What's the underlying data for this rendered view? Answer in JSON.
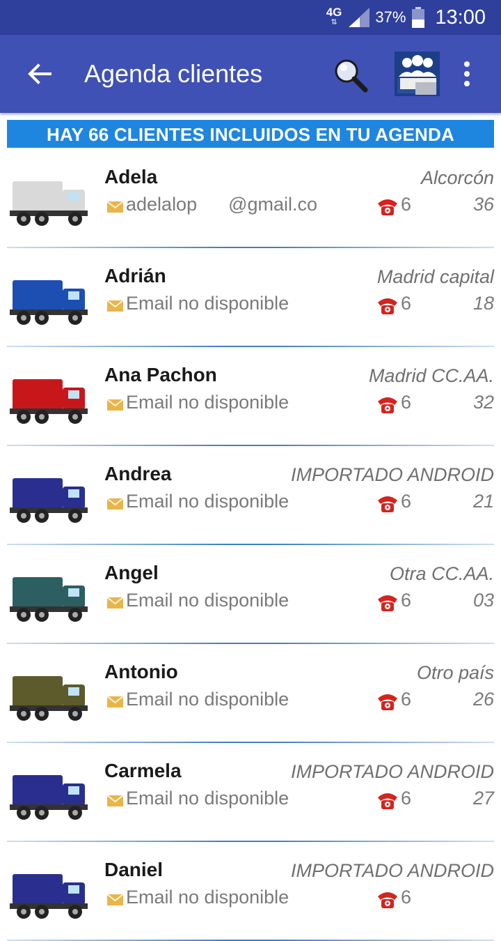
{
  "status_bar": {
    "network": "4G",
    "battery": "37%",
    "time": "13:00"
  },
  "app_bar": {
    "title": "Agenda clientes"
  },
  "banner": {
    "text": "HAY 66 CLIENTES INCLUIDOS EN TU AGENDA"
  },
  "clients": [
    {
      "name": "Adela",
      "region": "Alcorcón",
      "email": "adelalop      @gmail.co",
      "phone_start": "6",
      "phone_end": "36",
      "truck": "white-flatbed",
      "truck_color": "#d9d9d9"
    },
    {
      "name": "Adrián",
      "region": "Madrid capital",
      "email": "Email no disponible",
      "phone_start": "6",
      "phone_end": "18",
      "truck": "blue-box-truck",
      "truck_color": "#1d4fb3"
    },
    {
      "name": "Ana Pachon",
      "region": "Madrid CC.AA.",
      "email": "Email no disponible",
      "phone_start": "6",
      "phone_end": "32",
      "truck": "red-tractor",
      "truck_color": "#c8171b"
    },
    {
      "name": "Andrea",
      "region": "IMPORTADO ANDROID",
      "email": "Email no disponible",
      "phone_start": "6",
      "phone_end": "21",
      "truck": "navy-tractor",
      "truck_color": "#2a2f8f"
    },
    {
      "name": "Angel",
      "region": "Otra CC.AA.",
      "email": "Email no disponible",
      "phone_start": "6",
      "phone_end": "03",
      "truck": "teal-tractor",
      "truck_color": "#2b5f62"
    },
    {
      "name": "Antonio",
      "region": "Otro país",
      "email": "Email no disponible",
      "phone_start": "6",
      "phone_end": "26",
      "truck": "olive-tractor",
      "truck_color": "#5d5a2c"
    },
    {
      "name": "Carmela",
      "region": "IMPORTADO ANDROID",
      "email": "Email no disponible",
      "phone_start": "6",
      "phone_end": "27",
      "truck": "navy-tractor",
      "truck_color": "#2a2f8f"
    },
    {
      "name": "Daniel",
      "region": "IMPORTADO ANDROID",
      "email": "Email no disponible",
      "phone_start": "6",
      "phone_end": "",
      "truck": "navy-tractor",
      "truck_color": "#2a2f8f"
    }
  ]
}
